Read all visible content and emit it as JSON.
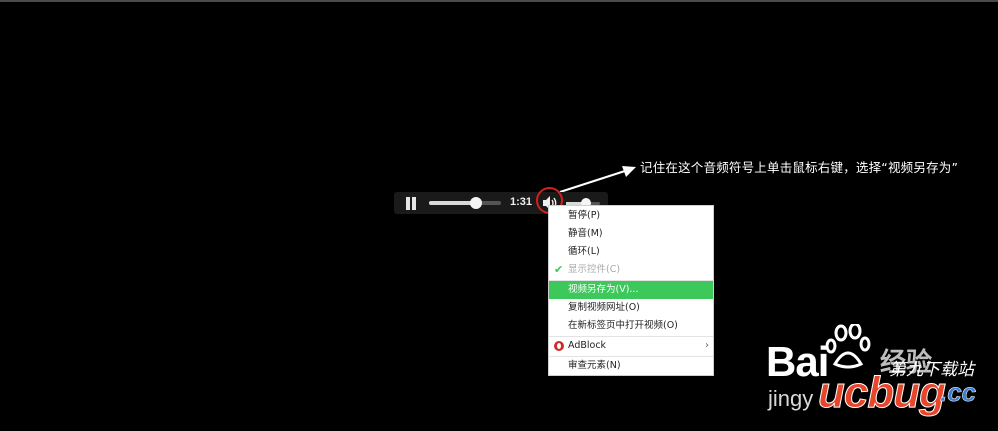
{
  "annotation": {
    "text": "记住在这个音频符号上单击鼠标右键，选择“视频另存为”"
  },
  "player": {
    "time": "1:31",
    "seek_progress": 0.65,
    "volume_level": 0.6,
    "icons": {
      "pause": "pause-icon",
      "volume": "speaker-icon"
    }
  },
  "context_menu": {
    "items": [
      {
        "label": "暂停(P)"
      },
      {
        "label": "静音(M)"
      },
      {
        "label": "循环(L)"
      },
      {
        "label": "显示控件(C)",
        "checked": true,
        "disabled": true
      },
      {
        "label": "视频另存为(V)...",
        "highlighted": true
      },
      {
        "label": "复制视频网址(O)"
      },
      {
        "label": "在新标签页中打开视频(O)"
      },
      {
        "label": "AdBlock",
        "icon": "adblock-icon",
        "has_submenu": true
      },
      {
        "label": "审查元素(N)"
      }
    ],
    "highlight_color": "#3cc85a"
  },
  "watermark": {
    "baidu": "Bai",
    "jingyan": "经验",
    "jingy": "jingy",
    "site_cn": "第九下载站",
    "logo": "ucbug",
    "logo_tld": ".cc"
  },
  "colors": {
    "background": "#000000",
    "annotation_circle": "#d21f1f",
    "logo_red": "#e8462c",
    "logo_blue": "#3b7fd4"
  }
}
